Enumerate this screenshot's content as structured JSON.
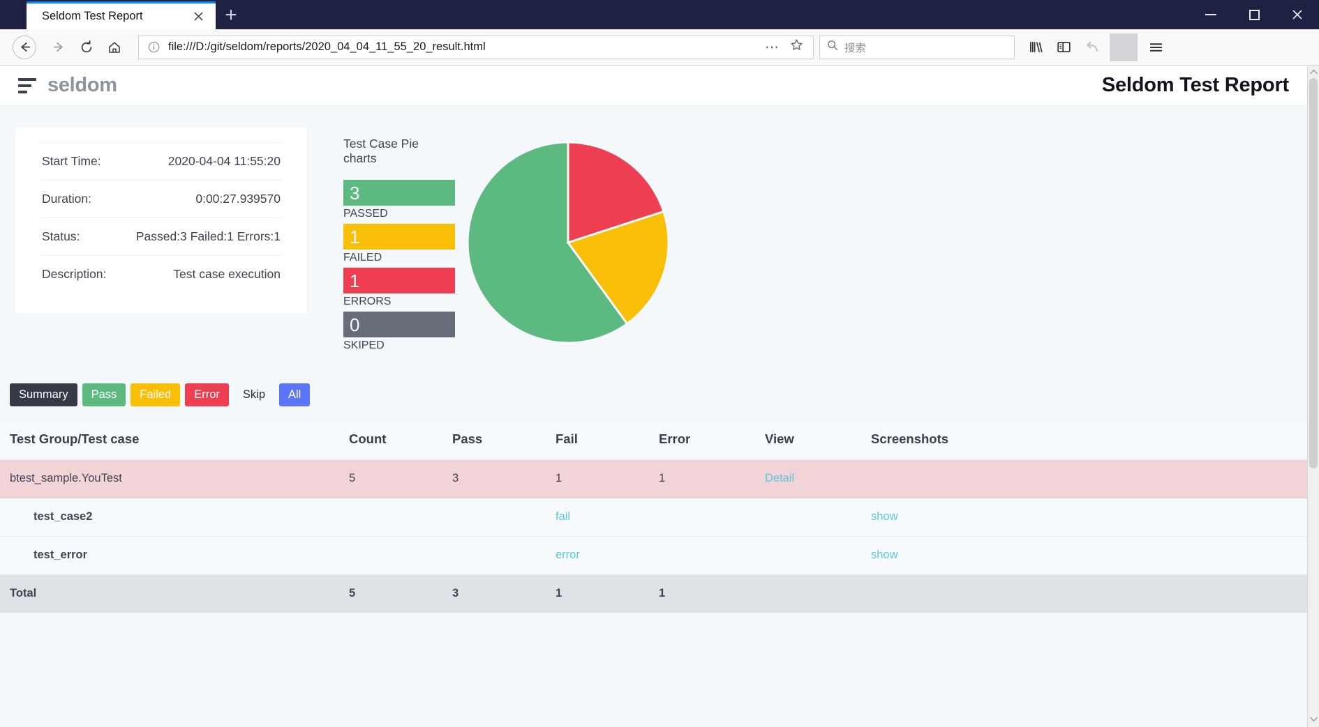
{
  "browser": {
    "tab": {
      "title": "Seldom Test Report",
      "close_icon": "close-icon"
    },
    "new_tab_label": "+",
    "window": {
      "minimize": "–",
      "maximize": "□",
      "close": "✕"
    },
    "nav": {
      "back_icon": "arrow-left-icon",
      "forward_icon": "arrow-right-icon",
      "reload_icon": "reload-icon",
      "home_icon": "home-icon"
    },
    "urlbar": {
      "info_icon": "info-circle-icon",
      "url": "file:///D:/git/seldom/reports/2020_04_04_11_55_20_result.html",
      "page_actions_icon": "ellipsis-icon",
      "bookmark_icon": "star-icon"
    },
    "search": {
      "icon": "search-icon",
      "placeholder": "搜索",
      "value": ""
    },
    "toolbar": {
      "library_icon": "library-icon",
      "sidebar_icon": "sidebar-icon",
      "sync_icon": "undo-arrow-icon",
      "menu_icon": "hamburger-menu-icon"
    }
  },
  "header": {
    "brand_icon": "stacked-lines-icon",
    "brand": "seldom",
    "title": "Seldom Test Report"
  },
  "info_card": {
    "rows": [
      {
        "label": "Start Time:",
        "value": "2020-04-04 11:55:20"
      },
      {
        "label": "Duration:",
        "value": "0:00:27.939570"
      },
      {
        "label": "Status:",
        "value": "Passed:3 Failed:1 Errors:1"
      },
      {
        "label": "Description:",
        "value": "Test case execution"
      }
    ]
  },
  "chart_data": {
    "type": "pie",
    "title": "Test Case Pie charts",
    "labels": [
      "PASSED",
      "FAILED",
      "ERRORS",
      "SKIPED"
    ],
    "values": [
      3,
      1,
      1,
      0
    ],
    "colors": [
      "#5cb97f",
      "#f9bf07",
      "#ee3f52",
      "#656d78"
    ],
    "legend_position": "left",
    "slices_drawn": [
      "PASSED",
      "ERRORS",
      "FAILED"
    ],
    "total": 5
  },
  "filters": [
    {
      "label": "Summary",
      "color": "#343a46",
      "text_color": "#ffffff"
    },
    {
      "label": "Pass",
      "color": "#5cb97f",
      "text_color": "#ffffff"
    },
    {
      "label": "Failed",
      "color": "#f9bf07",
      "text_color": "#ffffff"
    },
    {
      "label": "Error",
      "color": "#ee3f52",
      "text_color": "#ffffff"
    },
    {
      "label": "Skip",
      "color": "transparent",
      "text_color": "#2c3038"
    },
    {
      "label": "All",
      "color": "#5c75f6",
      "text_color": "#ffffff"
    }
  ],
  "table": {
    "headers": [
      "Test Group/Test case",
      "Count",
      "Pass",
      "Fail",
      "Error",
      "View",
      "Screenshots"
    ],
    "rows": [
      {
        "kind": "group",
        "name": "btest_sample.YouTest",
        "count": "5",
        "pass": "3",
        "fail": "1",
        "error": "1",
        "view": "Detail",
        "screenshots": ""
      },
      {
        "kind": "case-fail",
        "name": "test_case2",
        "count": "",
        "pass": "",
        "fail": "fail",
        "error": "",
        "view": "",
        "screenshots": "show"
      },
      {
        "kind": "case-error",
        "name": "test_error",
        "count": "",
        "pass": "",
        "fail": "error",
        "error": "",
        "view": "",
        "screenshots": "show"
      }
    ],
    "total": {
      "label": "Total",
      "count": "5",
      "pass": "3",
      "fail": "1",
      "error": "1",
      "view": "",
      "screenshots": ""
    }
  },
  "scrollbar": {
    "up": "▲",
    "down": "▼"
  }
}
